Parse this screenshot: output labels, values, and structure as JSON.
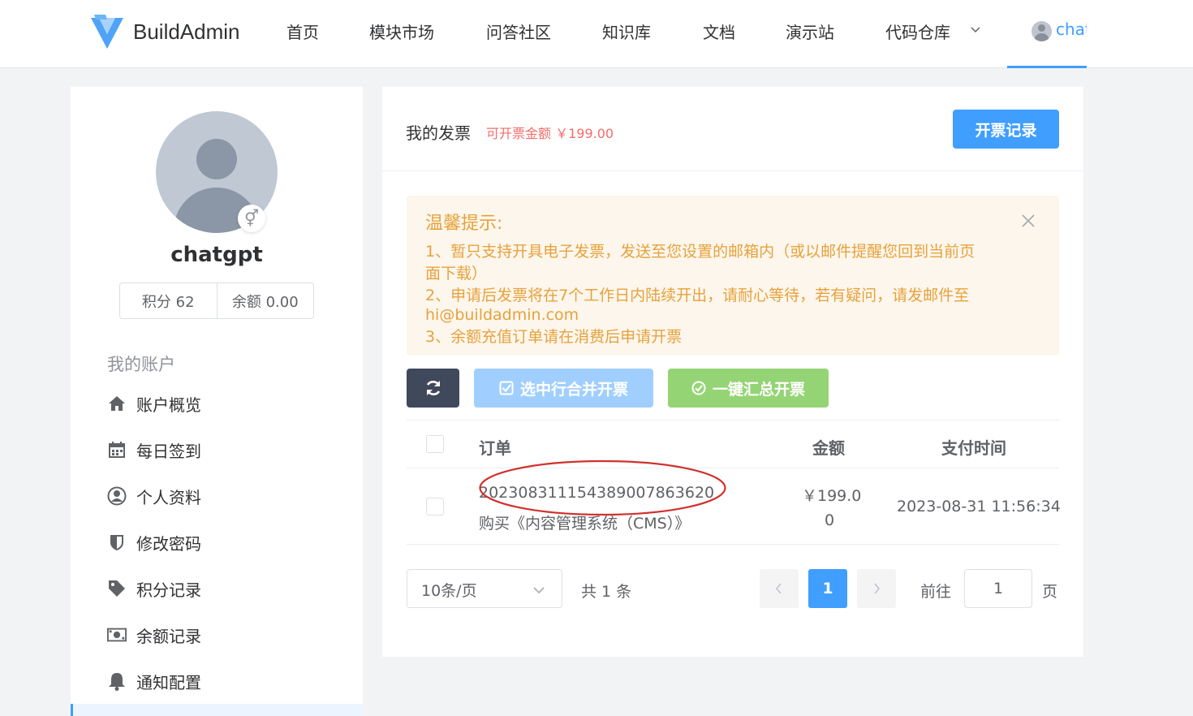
{
  "header": {
    "brand": "BuildAdmin",
    "nav": [
      "首页",
      "模块市场",
      "问答社区",
      "知识库",
      "文档",
      "演示站",
      "代码仓库"
    ],
    "user_name": "chat"
  },
  "sidebar": {
    "username": "chatgpt",
    "points": "积分 62",
    "balance": "余额 0.00",
    "menu_title": "我的账户",
    "items": [
      "账户概览",
      "每日签到",
      "个人资料",
      "修改密码",
      "积分记录",
      "余额记录",
      "通知配置"
    ]
  },
  "invoice": {
    "title": "我的发票",
    "amount_text": "可开票金额 ￥199.00",
    "records_button": "开票记录",
    "alert": {
      "title": "温馨提示:",
      "lines": [
        "1、暂只支持开具电子发票，发送至您设置的邮箱内（或以邮件提醒您回到当前页",
        "面下载）",
        "2、申请后发票将在7个工作日内陆续开出，请耐心等待，若有疑问，请发邮件至",
        "hi@buildadmin.com",
        "3、余额充值订单请在消费后申请开票"
      ]
    },
    "merge_button": "选中行合并开票",
    "summary_button": "一键汇总开票",
    "table": {
      "headers": [
        "订单",
        "金额",
        "支付时间"
      ],
      "rows": [
        {
          "order_no": "20230831115438900786362​0",
          "order_desc": "购买《内容管理系统（CMS）》",
          "amount_line1": "￥199.0",
          "amount_line2": "0",
          "paid_at": "2023-08-31 11:56:34"
        }
      ]
    },
    "pagination": {
      "page_size": "10条/页",
      "total": "共 1 条",
      "current_page": "1",
      "goto_label": "前往",
      "goto_value": "1",
      "goto_suffix": "页"
    }
  },
  "colors": {
    "primary": "#409eff",
    "danger_text": "#f56c6c",
    "warning_text": "#e6a23c",
    "annotation_oval": "#d0312d"
  }
}
